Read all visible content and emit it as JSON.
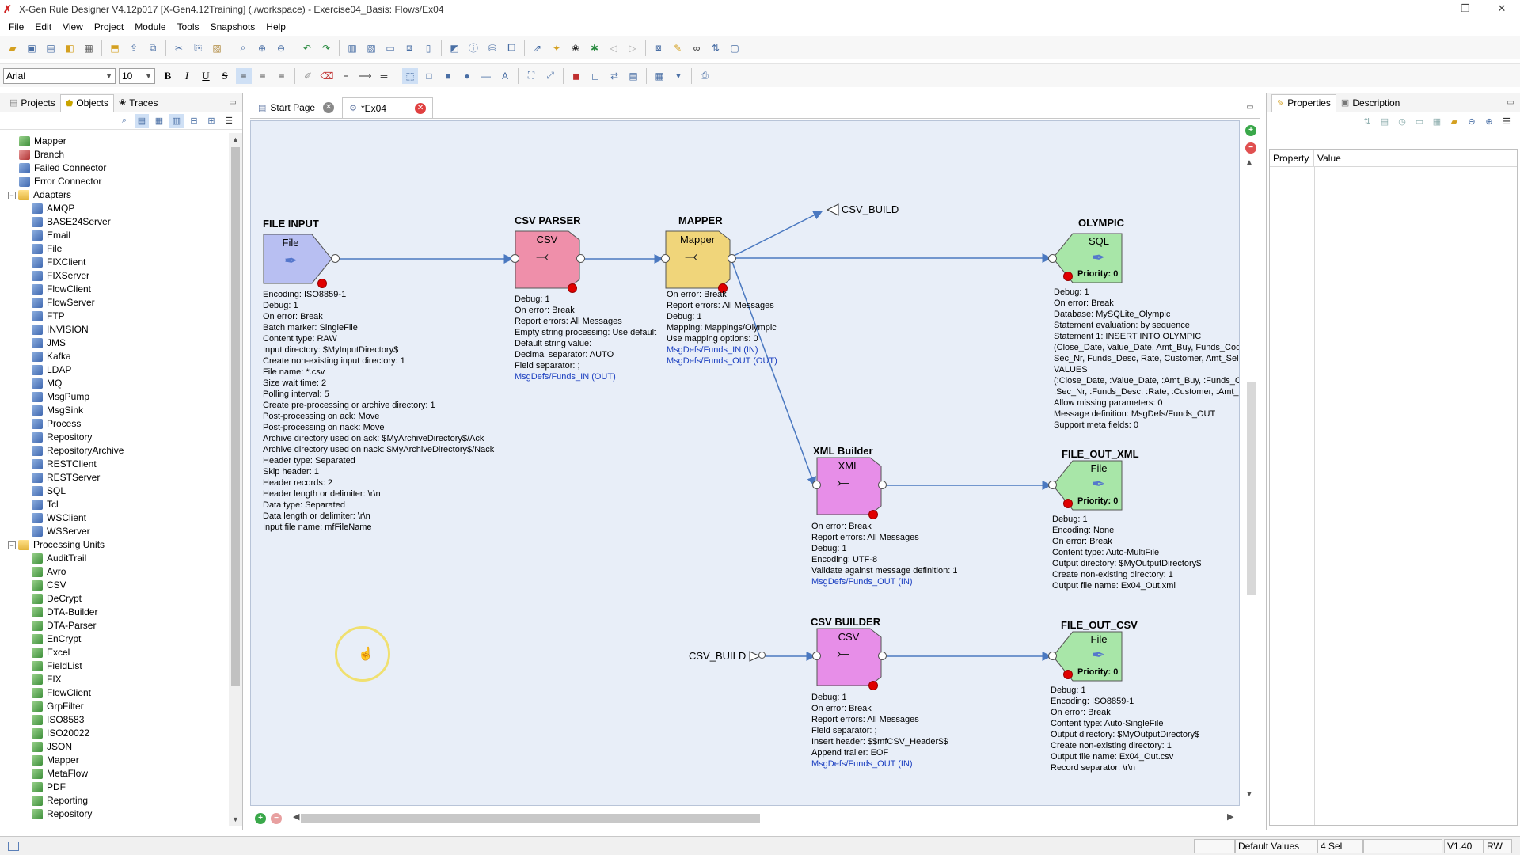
{
  "window": {
    "title": "X-Gen Rule Designer V4.12p017 [X-Gen4.12Training] (./workspace) - Exercise04_Basis: Flows/Ex04",
    "controls": [
      "—",
      "❐",
      "✕"
    ]
  },
  "menu": [
    "File",
    "Edit",
    "View",
    "Project",
    "Module",
    "Tools",
    "Snapshots",
    "Help"
  ],
  "format": {
    "font": "Arial",
    "size": "10",
    "bold": "B",
    "italic": "I",
    "underline": "U",
    "strike": "S"
  },
  "left_panel": {
    "tabs": [
      "Projects",
      "Objects",
      "Traces"
    ],
    "tree": [
      {
        "label": "Mapper",
        "level": 1,
        "icon": "green"
      },
      {
        "label": "Branch",
        "level": 1,
        "icon": "red"
      },
      {
        "label": "Failed Connector",
        "level": 1,
        "icon": "blue"
      },
      {
        "label": "Error Connector",
        "level": 1,
        "icon": "blue"
      },
      {
        "label": "Adapters",
        "level": 0,
        "icon": "folder",
        "expander": "−"
      },
      {
        "label": "AMQP",
        "level": 2,
        "icon": "blue"
      },
      {
        "label": "BASE24Server",
        "level": 2,
        "icon": "blue"
      },
      {
        "label": "Email",
        "level": 2,
        "icon": "blue"
      },
      {
        "label": "File",
        "level": 2,
        "icon": "blue"
      },
      {
        "label": "FIXClient",
        "level": 2,
        "icon": "blue"
      },
      {
        "label": "FIXServer",
        "level": 2,
        "icon": "blue"
      },
      {
        "label": "FlowClient",
        "level": 2,
        "icon": "blue"
      },
      {
        "label": "FlowServer",
        "level": 2,
        "icon": "blue"
      },
      {
        "label": "FTP",
        "level": 2,
        "icon": "blue"
      },
      {
        "label": "INVISION",
        "level": 2,
        "icon": "blue"
      },
      {
        "label": "JMS",
        "level": 2,
        "icon": "blue"
      },
      {
        "label": "Kafka",
        "level": 2,
        "icon": "blue"
      },
      {
        "label": "LDAP",
        "level": 2,
        "icon": "blue"
      },
      {
        "label": "MQ",
        "level": 2,
        "icon": "blue"
      },
      {
        "label": "MsgPump",
        "level": 2,
        "icon": "blue"
      },
      {
        "label": "MsgSink",
        "level": 2,
        "icon": "blue"
      },
      {
        "label": "Process",
        "level": 2,
        "icon": "blue"
      },
      {
        "label": "Repository",
        "level": 2,
        "icon": "blue"
      },
      {
        "label": "RepositoryArchive",
        "level": 2,
        "icon": "blue"
      },
      {
        "label": "RESTClient",
        "level": 2,
        "icon": "blue"
      },
      {
        "label": "RESTServer",
        "level": 2,
        "icon": "blue"
      },
      {
        "label": "SQL",
        "level": 2,
        "icon": "blue"
      },
      {
        "label": "Tcl",
        "level": 2,
        "icon": "blue"
      },
      {
        "label": "WSClient",
        "level": 2,
        "icon": "blue"
      },
      {
        "label": "WSServer",
        "level": 2,
        "icon": "blue"
      },
      {
        "label": "Processing Units",
        "level": 0,
        "icon": "folder",
        "expander": "−"
      },
      {
        "label": "AuditTrail",
        "level": 2,
        "icon": "green"
      },
      {
        "label": "Avro",
        "level": 2,
        "icon": "green"
      },
      {
        "label": "CSV",
        "level": 2,
        "icon": "green"
      },
      {
        "label": "DeCrypt",
        "level": 2,
        "icon": "green"
      },
      {
        "label": "DTA-Builder",
        "level": 2,
        "icon": "green"
      },
      {
        "label": "DTA-Parser",
        "level": 2,
        "icon": "green"
      },
      {
        "label": "EnCrypt",
        "level": 2,
        "icon": "green"
      },
      {
        "label": "Excel",
        "level": 2,
        "icon": "green"
      },
      {
        "label": "FieldList",
        "level": 2,
        "icon": "green"
      },
      {
        "label": "FIX",
        "level": 2,
        "icon": "green"
      },
      {
        "label": "FlowClient",
        "level": 2,
        "icon": "green"
      },
      {
        "label": "GrpFilter",
        "level": 2,
        "icon": "green"
      },
      {
        "label": "ISO8583",
        "level": 2,
        "icon": "green"
      },
      {
        "label": "ISO20022",
        "level": 2,
        "icon": "green"
      },
      {
        "label": "JSON",
        "level": 2,
        "icon": "green"
      },
      {
        "label": "Mapper",
        "level": 2,
        "icon": "green"
      },
      {
        "label": "MetaFlow",
        "level": 2,
        "icon": "green"
      },
      {
        "label": "PDF",
        "level": 2,
        "icon": "green"
      },
      {
        "label": "Reporting",
        "level": 2,
        "icon": "green"
      },
      {
        "label": "Repository",
        "level": 2,
        "icon": "green"
      }
    ]
  },
  "editor": {
    "tabs": [
      {
        "label": "Start Page",
        "active": false
      },
      {
        "label": "*Ex04",
        "active": true
      }
    ]
  },
  "flow": {
    "file_input": {
      "title": "FILE INPUT",
      "label": "File",
      "props": [
        "Encoding: ISO8859-1",
        "Debug: 1",
        "On error: Break",
        "Batch marker: SingleFile",
        "Content type: RAW",
        "Input directory: $MyInputDirectory$",
        "Create non-existing input directory: 1",
        "File name: *.csv",
        "Size wait time: 2",
        "Polling interval: 5",
        "Create pre-processing or archive directory: 1",
        "Post-processing on ack: Move",
        "Post-processing on nack: Move",
        "Archive directory used on ack: $MyArchiveDirectory$/Ack",
        "Archive directory used on nack: $MyArchiveDirectory$/Nack",
        "Header type: Separated",
        "Skip header: 1",
        "Header records: 2",
        "Header length or delimiter: \\r\\n",
        "Data type: Separated",
        "Data length or delimiter: \\r\\n",
        "Input file name: mfFileName"
      ]
    },
    "csv_parser": {
      "title": "CSV PARSER",
      "label": "CSV",
      "props": [
        "Debug: 1",
        "On error: Break",
        "Report errors: All Messages",
        "Empty string processing: Use default",
        "Default string value:",
        "Decimal separator: AUTO",
        "Field separator: ;"
      ],
      "links": [
        "MsgDefs/Funds_IN (OUT)"
      ]
    },
    "mapper": {
      "title": "MAPPER",
      "label": "Mapper",
      "props": [
        "On error: Break",
        "Report errors: All Messages",
        "Debug: 1",
        "Mapping: Mappings/Olympic",
        "Use mapping options: 0"
      ],
      "links": [
        "MsgDefs/Funds_IN (IN)",
        "MsgDefs/Funds_OUT (OUT)"
      ]
    },
    "csv_build_out": {
      "label": "CSV_BUILD"
    },
    "olympic": {
      "title": "OLYMPIC",
      "label": "SQL",
      "priority": "Priority: 0",
      "props": [
        "Debug: 1",
        "On error: Break",
        "Database: MySQLite_Olympic",
        "Statement evaluation: by sequence",
        "Statement 1: INSERT INTO OLYMPIC",
        "(Close_Date, Value_Date, Amt_Buy, Funds_Code,",
        "Sec_Nr, Funds_Desc, Rate, Customer, Amt_Sell)",
        "VALUES",
        "(:Close_Date, :Value_Date, :Amt_Buy, :Funds_Code,",
        ":Sec_Nr, :Funds_Desc, :Rate, :Customer, :Amt_Sell)",
        "Allow missing parameters: 0",
        "Message definition: MsgDefs/Funds_OUT",
        "Support meta fields: 0"
      ]
    },
    "xml_builder": {
      "title": "XML Builder",
      "label": "XML",
      "props": [
        "On error: Break",
        "Report errors: All Messages",
        "Debug: 1",
        "Encoding: UTF-8",
        "Validate against message definition: 1"
      ],
      "links": [
        "MsgDefs/Funds_OUT (IN)"
      ]
    },
    "file_out_xml": {
      "title": "FILE_OUT_XML",
      "label": "File",
      "priority": "Priority: 0",
      "props": [
        "Debug: 1",
        "Encoding: None",
        "On error: Break",
        "Content type: Auto-MultiFile",
        "Output directory: $MyOutputDirectory$",
        "Create non-existing directory: 1",
        "Output file name: Ex04_Out.xml"
      ]
    },
    "csv_build_in": {
      "label": "CSV_BUILD"
    },
    "csv_builder": {
      "title": "CSV BUILDER",
      "label": "CSV",
      "props": [
        "Debug: 1",
        "On error: Break",
        "Report errors: All Messages",
        "Field separator: ;",
        "Insert header: $$mfCSV_Header$$",
        "Append trailer: EOF"
      ],
      "links": [
        "MsgDefs/Funds_OUT (IN)"
      ]
    },
    "file_out_csv": {
      "title": "FILE_OUT_CSV",
      "label": "File",
      "priority": "Priority: 0",
      "props": [
        "Debug: 1",
        "Encoding: ISO8859-1",
        "On error: Break",
        "Content type: Auto-SingleFile",
        "Output directory: $MyOutputDirectory$",
        "Create non-existing directory: 1",
        "Output file name: Ex04_Out.csv",
        "Record separator: \\r\\n"
      ]
    }
  },
  "colors": {
    "adapter_input": "#b8bff2",
    "csv_parser": "#ef8faa",
    "mapper": "#f0d57a",
    "sql_output": "#a8e6a8",
    "builder": "#e78ee8",
    "canvas": "#e8eef8",
    "connector": "#4a78c0"
  },
  "right_panel": {
    "tabs": [
      "Properties",
      "Description"
    ],
    "columns": [
      "Property",
      "Value"
    ]
  },
  "status": {
    "mode": "Default Values",
    "selection": "4 Sel",
    "version": "V1.40",
    "access": "RW"
  }
}
